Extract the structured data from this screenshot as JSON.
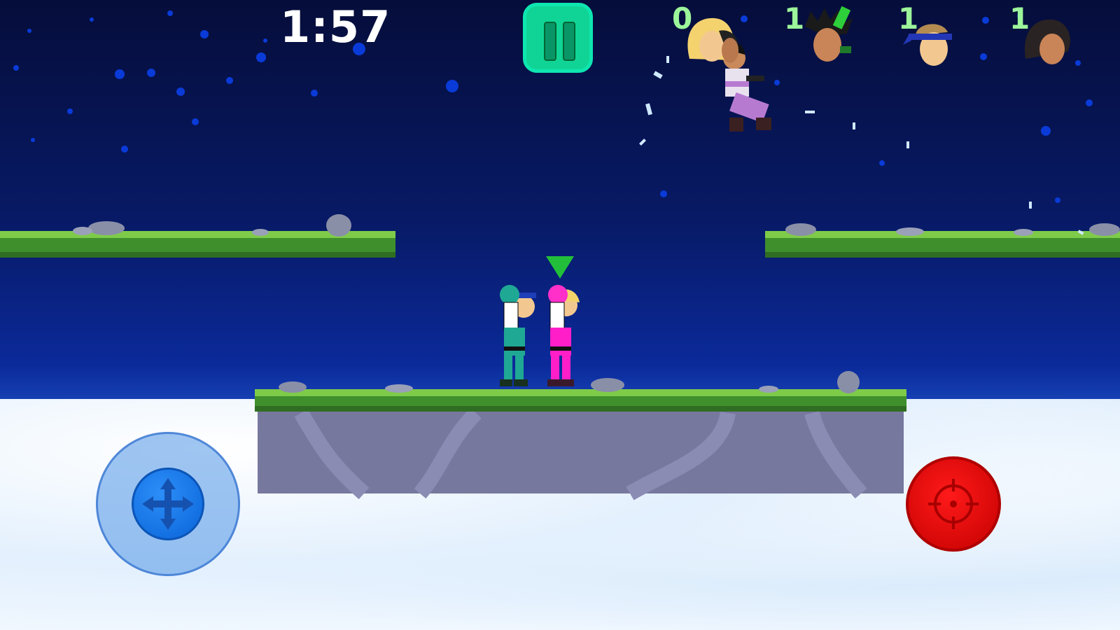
{
  "hud": {
    "timer": "1:57",
    "players": [
      {
        "score": "0"
      },
      {
        "score": "1"
      },
      {
        "score": "1"
      },
      {
        "score": "1"
      }
    ]
  },
  "colors": {
    "pause_button": "#10d495",
    "fire_button": "#d40000",
    "joystick": "#1a78e8",
    "score_text": "#9cf59a",
    "player_pink": "#ff1ec8",
    "player_teal": "#1fa894"
  },
  "icons": {
    "pause": "pause-icon",
    "move": "move-arrows-icon",
    "fire": "crosshair-icon",
    "marker": "player-indicator-arrow-icon"
  }
}
